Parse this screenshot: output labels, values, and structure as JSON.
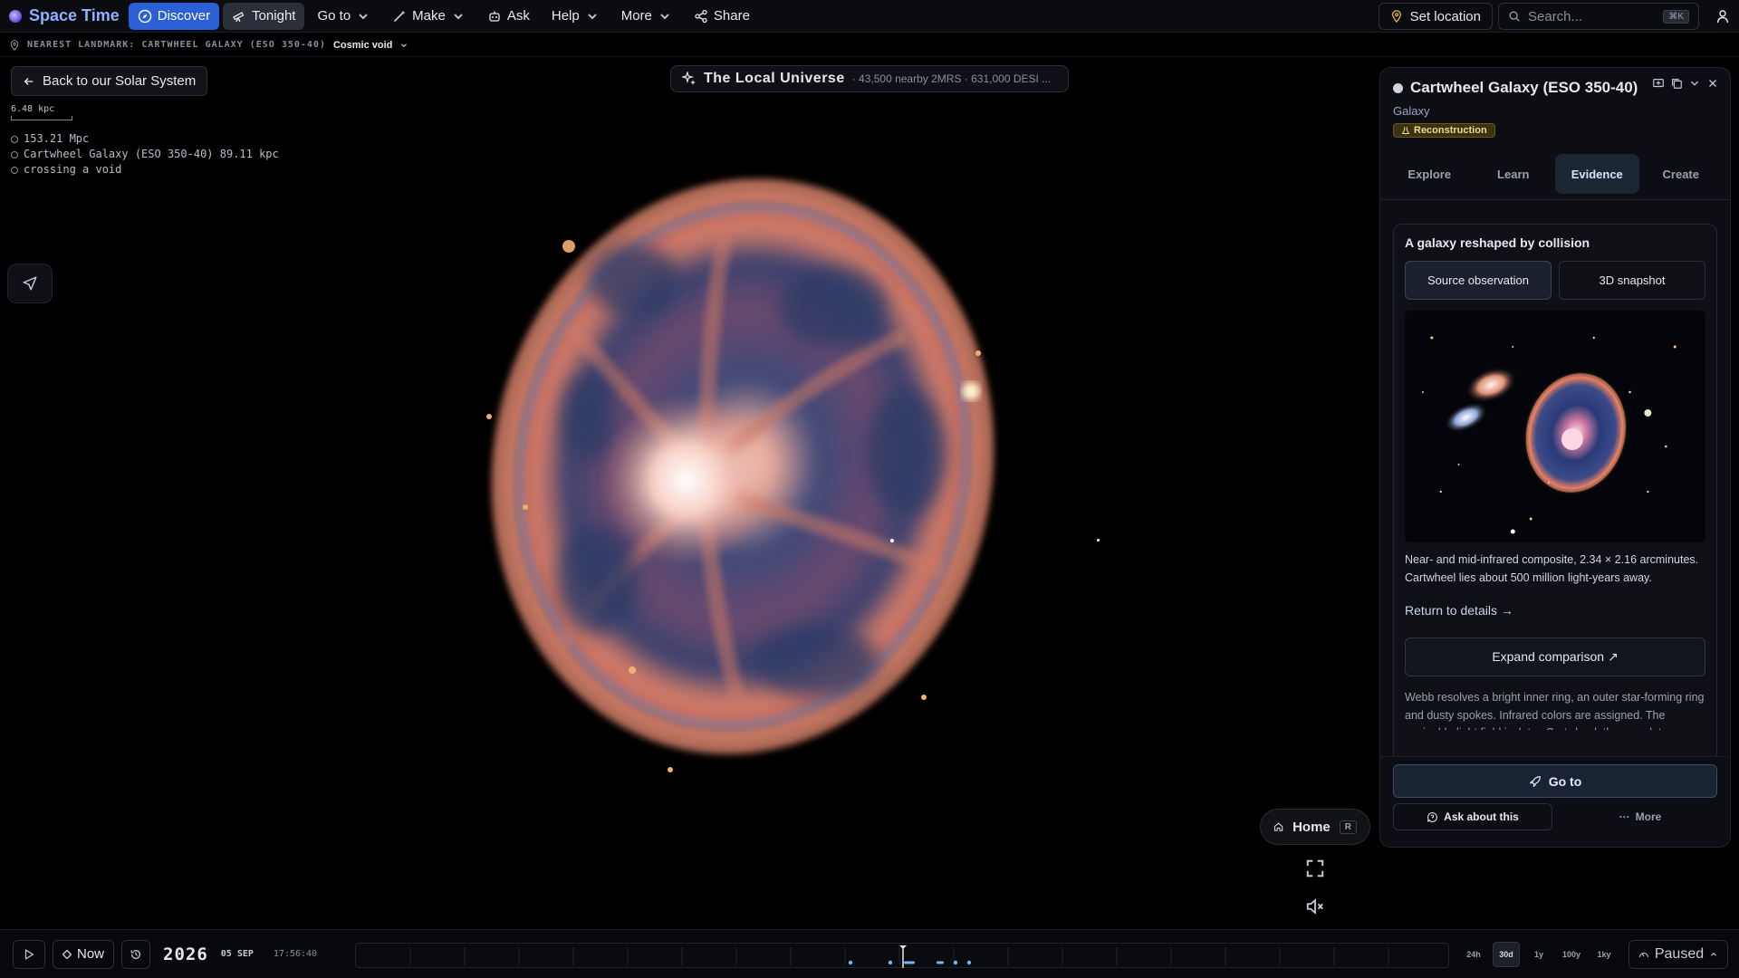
{
  "app": {
    "name": "Space Time"
  },
  "nav": {
    "discover": "Discover",
    "tonight": "Tonight",
    "goto": "Go to",
    "make": "Make",
    "ask": "Ask",
    "help": "Help",
    "more": "More",
    "share": "Share",
    "set_location": "Set location",
    "search_placeholder": "Search...",
    "search_shortcut": "⌘K"
  },
  "landmark": {
    "label": "NEAREST LANDMARK: CARTWHEEL GALAXY (ESO 350-40)",
    "value": "Cosmic void"
  },
  "viewport": {
    "back_label": "Back to our Solar System",
    "scale_label": "6.48 kpc",
    "hud": [
      "153.21 Mpc",
      "Cartwheel Galaxy (ESO 350-40) 89.11 kpc",
      "crossing a void"
    ],
    "universe_title": "The Local Universe",
    "universe_sub": "· 43,500 nearby 2MRS · 631,000 DESI ..."
  },
  "panel": {
    "title": "Cartwheel Galaxy (ESO 350-40)",
    "type": "Galaxy",
    "badge": "Reconstruction",
    "tabs": [
      "Explore",
      "Learn",
      "Evidence",
      "Create"
    ],
    "active_tab": "Evidence",
    "card_title": "A galaxy reshaped by collision",
    "toggle": [
      "Source observation",
      "3D snapshot"
    ],
    "caption": "Near- and mid-infrared composite, 2.34 × 2.16 arcminutes. Cartwheel lies about 500 million light-years away.",
    "return_link": "Return to details →",
    "expand_label": "Expand comparison ↗",
    "description": "Webb resolves a bright inner ring, an outer star-forming ring and dusty spokes. Infrared colors are assigned. The navigable light field isolates Cartwheel; the complete",
    "goto_label": "Go to",
    "ask_label": "Ask about this",
    "more_label": "More"
  },
  "controls": {
    "home_label": "Home",
    "home_key": "R"
  },
  "timeline": {
    "now_label": "Now",
    "year": "2026",
    "date": "05 SEP",
    "time": "17:56:40",
    "ranges": [
      "24h",
      "30d",
      "1y",
      "100y",
      "1ky"
    ],
    "active_range": "30d",
    "status": "Paused"
  },
  "colors": {
    "accent": "#2a5fd6",
    "brand": "#8db0ff",
    "badge": "#f0d98a"
  }
}
